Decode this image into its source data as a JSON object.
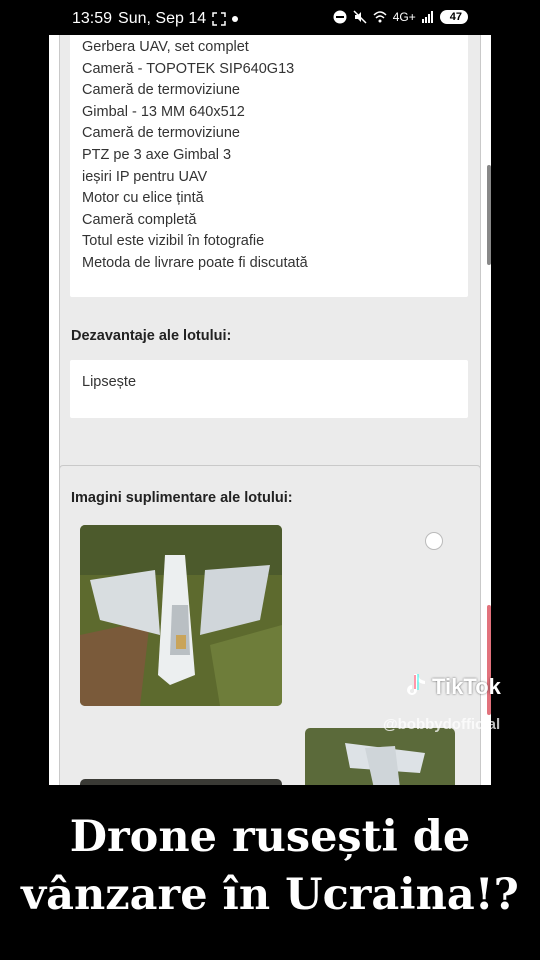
{
  "status_bar": {
    "time": "13:59",
    "date": "Sun, Sep 14",
    "network": "4G+",
    "battery": "47"
  },
  "lot_details": {
    "features": [
      "Gerbera UAV, set complet",
      "Cameră - TOPOTEK SIP640G13",
      "Cameră de termoviziune",
      "Gimbal - 13 MM 640x512",
      "Cameră de termoviziune",
      "PTZ pe 3 axe Gimbal 3",
      "ieșiri IP pentru UAV",
      "Motor cu elice țintă",
      "Cameră completă",
      "Totul este vizibil în fotografie",
      "Metoda de livrare poate fi discutată"
    ],
    "disadvantages_heading": "Dezavantaje ale lotului:",
    "disadvantages_value": "Lipsește",
    "additional_images_heading": "Imagini suplimentare ale lotului:"
  },
  "watermark": {
    "brand": "TikTok",
    "username": "@bobbydofficial"
  },
  "caption": {
    "line1": "Drone rusești de",
    "line2": "vânzare în Ucraina!?"
  },
  "colors": {
    "panel_bg": "#ebebeb",
    "page_bg": "#000000",
    "scroll_accent": "#e2727c"
  }
}
